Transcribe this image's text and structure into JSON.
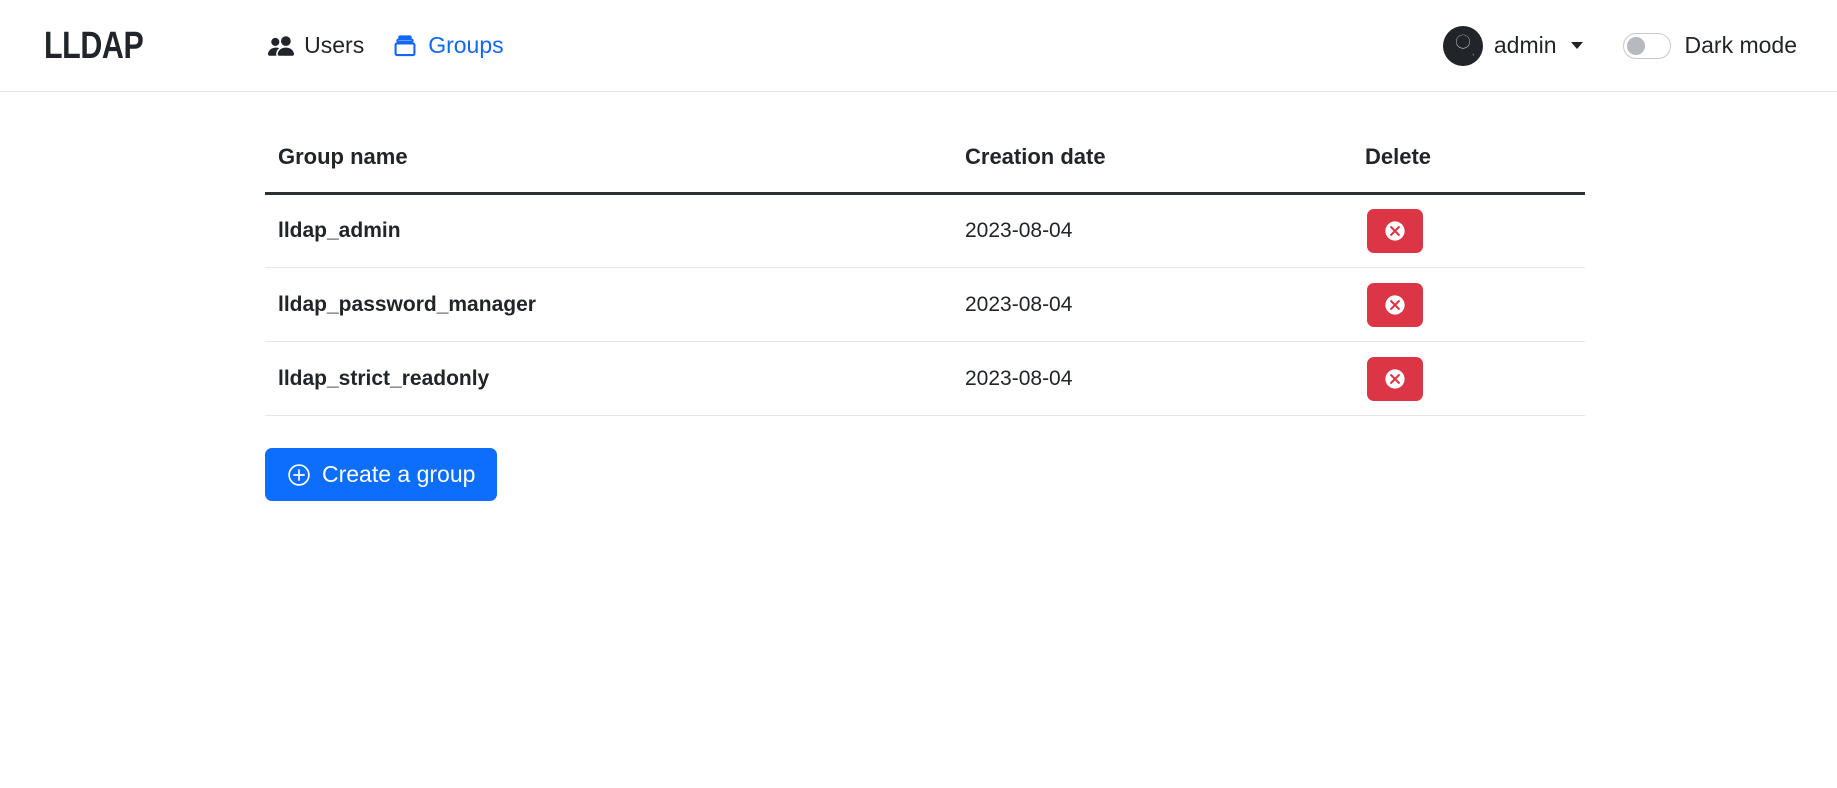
{
  "header": {
    "brand": "LLDAP",
    "nav": [
      {
        "label": "Users",
        "icon": "users-icon",
        "active": false
      },
      {
        "label": "Groups",
        "icon": "groups-icon",
        "active": true
      }
    ],
    "user": {
      "name": "admin",
      "avatar_icon": "user-avatar-icon",
      "caret_icon": "chevron-down-icon"
    },
    "dark_mode": {
      "label": "Dark mode",
      "enabled": false
    }
  },
  "table": {
    "columns": [
      "Group name",
      "Creation date",
      "Delete"
    ],
    "rows": [
      {
        "name": "lldap_admin",
        "creation_date": "2023-08-04",
        "delete_icon": "x-circle-icon"
      },
      {
        "name": "lldap_password_manager",
        "creation_date": "2023-08-04",
        "delete_icon": "x-circle-icon"
      },
      {
        "name": "lldap_strict_readonly",
        "creation_date": "2023-08-04",
        "delete_icon": "x-circle-icon"
      }
    ]
  },
  "actions": {
    "create_group_label": "Create a group",
    "create_group_icon": "plus-circle-icon"
  },
  "colors": {
    "accent_blue": "#0d6efd",
    "link_blue": "#1367f5",
    "danger_red": "#dc3545",
    "text": "#212529",
    "border": "#e6e7e9"
  }
}
